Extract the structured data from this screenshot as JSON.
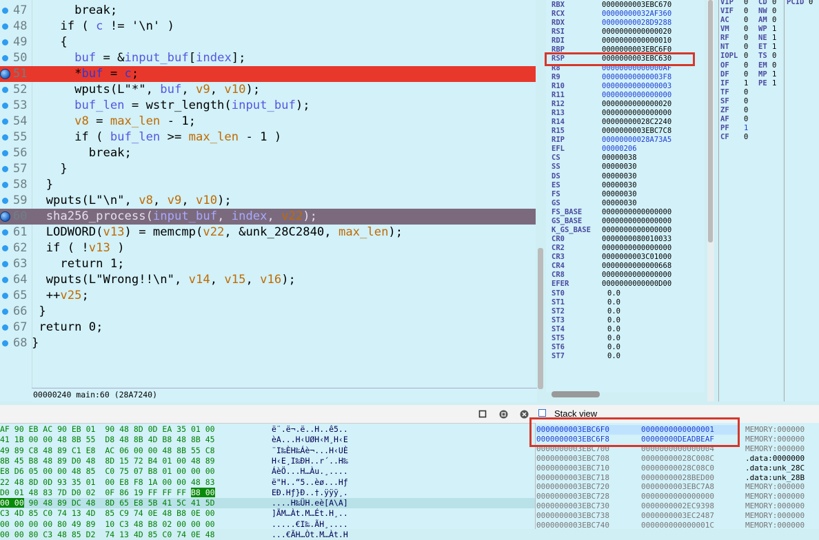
{
  "code": {
    "lines": [
      {
        "num": "47",
        "text": "      break;",
        "kind": "normal"
      },
      {
        "num": "48",
        "text": "    if ( c != '\\n' )",
        "kind": "normal"
      },
      {
        "num": "49",
        "text": "    {",
        "kind": "normal"
      },
      {
        "num": "50",
        "text": "      buf = &input_buf[index];",
        "kind": "normal"
      },
      {
        "num": "51",
        "text": "      *buf = c;",
        "kind": "breakpoint"
      },
      {
        "num": "52",
        "text": "      wputs(L\"*\", buf, v9, v10);",
        "kind": "normal"
      },
      {
        "num": "53",
        "text": "      buf_len = wstr_length(input_buf);",
        "kind": "normal"
      },
      {
        "num": "54",
        "text": "      v8 = max_len - 1;",
        "kind": "normal"
      },
      {
        "num": "55",
        "text": "      if ( buf_len >= max_len - 1 )",
        "kind": "normal"
      },
      {
        "num": "56",
        "text": "        break;",
        "kind": "normal"
      },
      {
        "num": "57",
        "text": "    }",
        "kind": "normal"
      },
      {
        "num": "58",
        "text": "  }",
        "kind": "normal"
      },
      {
        "num": "59",
        "text": "  wputs(L\"\\n\", v8, v9, v10);",
        "kind": "normal"
      },
      {
        "num": "60",
        "text": "  sha256_process(input_buf, index, v22);",
        "kind": "current"
      },
      {
        "num": "61",
        "text": "  LODWORD(v13) = memcmp(v22, &unk_28C2840, max_len);",
        "kind": "normal"
      },
      {
        "num": "62",
        "text": "  if ( !v13 )",
        "kind": "normal"
      },
      {
        "num": "63",
        "text": "    return 1;",
        "kind": "normal"
      },
      {
        "num": "64",
        "text": "  wputs(L\"Wrong!!\\n\", v14, v15, v16);",
        "kind": "normal"
      },
      {
        "num": "65",
        "text": "  ++v25;",
        "kind": "normal"
      },
      {
        "num": "66",
        "text": " }",
        "kind": "normal"
      },
      {
        "num": "67",
        "text": " return 0;",
        "kind": "normal"
      },
      {
        "num": "68",
        "text": "}",
        "kind": "normal"
      }
    ],
    "status": "00000240 main:60 (28A7240)"
  },
  "registers": [
    {
      "name": "RBX",
      "value": "0000000003EBC670",
      "style": "plain"
    },
    {
      "name": "RCX",
      "value": "00000000032AF360",
      "style": "blue"
    },
    {
      "name": "RDX",
      "value": "00000000028D9288",
      "style": "blue"
    },
    {
      "name": "RSI",
      "value": "0000000000000020",
      "style": "plain"
    },
    {
      "name": "RDI",
      "value": "0000000000000010",
      "style": "plain"
    },
    {
      "name": "RBP",
      "value": "0000000003EBC6F0",
      "style": "plain"
    },
    {
      "name": "RSP",
      "value": "0000000003EBC630",
      "style": "plain"
    },
    {
      "name": "R8",
      "value": "00000000000000AF",
      "style": "blue"
    },
    {
      "name": "R9",
      "value": "00000000000003F8",
      "style": "blue"
    },
    {
      "name": "R10",
      "value": "0000000000000003",
      "style": "blue"
    },
    {
      "name": "R11",
      "value": "0000000000000000",
      "style": "blue"
    },
    {
      "name": "R12",
      "value": "0000000000000020",
      "style": "plain"
    },
    {
      "name": "R13",
      "value": "0000000000000000",
      "style": "plain"
    },
    {
      "name": "R14",
      "value": "00000000028C2240",
      "style": "plain"
    },
    {
      "name": "R15",
      "value": "0000000003EBC7C8",
      "style": "plain"
    },
    {
      "name": "RIP",
      "value": "00000000028A73A5",
      "style": "blue"
    },
    {
      "name": "EFL",
      "value": "00000206",
      "style": "blue"
    },
    {
      "name": "CS",
      "value": "00000038",
      "style": "plain"
    },
    {
      "name": "SS",
      "value": "00000030",
      "style": "plain"
    },
    {
      "name": "DS",
      "value": "00000030",
      "style": "plain"
    },
    {
      "name": "ES",
      "value": "00000030",
      "style": "plain"
    },
    {
      "name": "FS",
      "value": "00000030",
      "style": "plain"
    },
    {
      "name": "GS",
      "value": "00000030",
      "style": "plain"
    },
    {
      "name": "FS_BASE",
      "value": "0000000000000000",
      "style": "plain"
    },
    {
      "name": "GS_BASE",
      "value": "0000000000000000",
      "style": "plain"
    },
    {
      "name": "K_GS_BASE",
      "value": "0000000000000000",
      "style": "plain"
    },
    {
      "name": "CR0",
      "value": "0000000080010033",
      "style": "plain"
    },
    {
      "name": "CR2",
      "value": "0000000000000000",
      "style": "plain"
    },
    {
      "name": "CR3",
      "value": "0000000003C01000",
      "style": "plain"
    },
    {
      "name": "CR4",
      "value": "0000000000000668",
      "style": "plain"
    },
    {
      "name": "CR8",
      "value": "0000000000000000",
      "style": "plain"
    },
    {
      "name": "EFER",
      "value": "0000000000000D00",
      "style": "plain"
    },
    {
      "name": "ST0",
      "value": "0.0",
      "style": "plain"
    },
    {
      "name": "ST1",
      "value": "0.0",
      "style": "plain"
    },
    {
      "name": "ST2",
      "value": "0.0",
      "style": "plain"
    },
    {
      "name": "ST3",
      "value": "0.0",
      "style": "plain"
    },
    {
      "name": "ST4",
      "value": "0.0",
      "style": "plain"
    },
    {
      "name": "ST5",
      "value": "0.0",
      "style": "plain"
    },
    {
      "name": "ST6",
      "value": "0.0",
      "style": "plain"
    },
    {
      "name": "ST7",
      "value": "0.0",
      "style": "plain"
    }
  ],
  "flags": [
    {
      "name": "VIP",
      "value": "0",
      "blue": false
    },
    {
      "name": "VIF",
      "value": "0",
      "blue": false
    },
    {
      "name": "AC",
      "value": "0",
      "blue": false
    },
    {
      "name": "VM",
      "value": "0",
      "blue": false
    },
    {
      "name": "RF",
      "value": "0",
      "blue": false
    },
    {
      "name": "NT",
      "value": "0",
      "blue": false
    },
    {
      "name": "IOPL",
      "value": "0",
      "blue": false
    },
    {
      "name": "OF",
      "value": "0",
      "blue": false
    },
    {
      "name": "DF",
      "value": "0",
      "blue": false
    },
    {
      "name": "IF",
      "value": "1",
      "blue": false
    },
    {
      "name": "TF",
      "value": "0",
      "blue": false
    },
    {
      "name": "SF",
      "value": "0",
      "blue": false
    },
    {
      "name": "ZF",
      "value": "0",
      "blue": false
    },
    {
      "name": "AF",
      "value": "0",
      "blue": false
    },
    {
      "name": "PF",
      "value": "1",
      "blue": true
    },
    {
      "name": "CF",
      "value": "0",
      "blue": false
    }
  ],
  "cr0flags": [
    {
      "name": "CD",
      "value": "0"
    },
    {
      "name": "NW",
      "value": "0"
    },
    {
      "name": "AM",
      "value": "0"
    },
    {
      "name": "WP",
      "value": "1"
    },
    {
      "name": "NE",
      "value": "1"
    },
    {
      "name": "ET",
      "value": "1"
    },
    {
      "name": "TS",
      "value": "0"
    },
    {
      "name": "EM",
      "value": "0"
    },
    {
      "name": "MP",
      "value": "1"
    },
    {
      "name": "PE",
      "value": "1"
    }
  ],
  "cr4flags": [
    {
      "name": "PCID",
      "value": "0"
    }
  ],
  "hex": {
    "rows": [
      {
        "hex": "AF 90 EB AC 90 EB 01  90 48 8D 0D EA 35 01 00",
        "ascii": "ë¨.ë¬.ë..H..ê5.."
      },
      {
        "hex": "41 1B 00 00 48 8B 55  D8 48 8B 4D B8 48 8B 45",
        "ascii": "èA...H‹UØH‹M¸H‹E"
      },
      {
        "hex": "49 89 C8 48 89 C1 E8  AC 06 00 00 48 8B 55 C8",
        "ascii": "¨I‰ÈH‰Áè¬...H‹UÈ"
      },
      {
        "hex": "8B 45 B8 48 89 D0 48  8D 15 72 B4 01 00 48 89",
        "ascii": "H‹E¸I‰ÐH..r´..H‰"
      },
      {
        "hex": "E8 D6 05 00 00 48 85  C0 75 07 B8 01 00 00 00",
        "ascii": "ÁèÖ...H…Àu.¸...."
      },
      {
        "hex": "22 48 8D 0D 93 35 01  00 E8 F8 1A 00 00 48 83",
        "ascii": "ë\"H..“5..èø...Hƒ"
      },
      {
        "hex": "D0 01 48 83 7D D0 02  0F 86 19 FF FF FF B8 00",
        "ascii": "EÐ.Hƒ}Ð..†.ÿÿÿ¸."
      },
      {
        "hex": "00 00 90 48 89 DC 48  8D 65 E8 5B 41 5C 41 5D",
        "ascii": "....H‰ÜH.eè[A\\A]"
      },
      {
        "hex": "C3 4D 85 C0 74 13 4D  85 C9 74 0E 48 B8 0E 00",
        "ascii": "]ÃM…Àt.M…Ét.H¸.."
      },
      {
        "hex": "00 00 00 00 80 49 89  10 C3 48 B8 02 00 00 00",
        "ascii": ".....€I‰.ÃH¸...."
      },
      {
        "hex": "00 00 80 C3 48 85 D2  74 13 4D 85 C0 74 0E 48",
        "ascii": "...€ÃH…Òt.M…Àt.H"
      }
    ]
  },
  "stack": {
    "title": "Stack view",
    "rows": [
      {
        "addr": "0000000003EBC6F0",
        "val": "0000000000000001",
        "cmt": "MEMORY:000000"
      },
      {
        "addr": "0000000003EBC6F8",
        "val": "00000000DEADBEAF",
        "cmt": "MEMORY:000000"
      },
      {
        "addr": "0000000003EBC700",
        "val": "0000000000000004",
        "cmt": "MEMORY:000000"
      },
      {
        "addr": "0000000003EBC708",
        "val": "00000000028C008C",
        "cmt": ".data:0000000"
      },
      {
        "addr": "0000000003EBC710",
        "val": "00000000028C08C0",
        "cmt": ".data:unk_28C"
      },
      {
        "addr": "0000000003EBC718",
        "val": "00000000028BED00",
        "cmt": ".data:unk_28B"
      },
      {
        "addr": "0000000003EBC720",
        "val": "0000000003EBC7A8",
        "cmt": "MEMORY:000000"
      },
      {
        "addr": "0000000003EBC728",
        "val": "0000000000000000",
        "cmt": "MEMORY:000000"
      },
      {
        "addr": "0000000003EBC730",
        "val": "0000000002EC9398",
        "cmt": "MEMORY:000000"
      },
      {
        "addr": "0000000003EBC738",
        "val": "0000000003EC2487",
        "cmt": "MEMORY:000000"
      },
      {
        "addr": "0000000003EBC740",
        "val": "000000000000001C",
        "cmt": "MEMORY:000000"
      }
    ]
  }
}
